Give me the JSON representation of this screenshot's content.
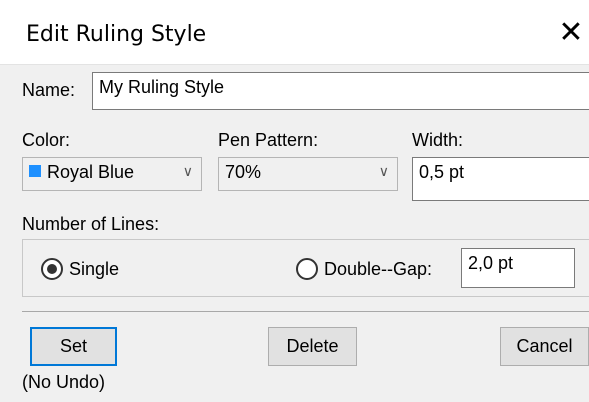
{
  "window": {
    "title": "Edit Ruling Style",
    "close_glyph": "✕"
  },
  "name": {
    "label": "Name:",
    "value": "My Ruling Style"
  },
  "color": {
    "label": "Color:",
    "value": "Royal Blue",
    "swatch": "#1e90ff"
  },
  "pen_pattern": {
    "label": "Pen Pattern:",
    "value": "70%"
  },
  "width": {
    "label": "Width:",
    "value": "0,5 pt"
  },
  "lines": {
    "label": "Number of Lines:",
    "single_label": "Single",
    "single_selected": true,
    "double_label": "Double--Gap:",
    "double_selected": false,
    "gap_value": "2,0 pt"
  },
  "buttons": {
    "set": "Set",
    "delete": "Delete",
    "cancel": "Cancel"
  },
  "note": "(No Undo)",
  "chevron": "∨"
}
